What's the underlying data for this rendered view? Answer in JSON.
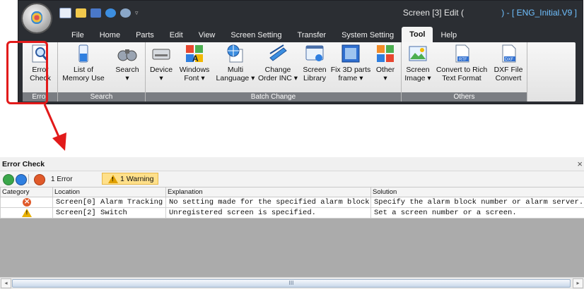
{
  "window": {
    "title_prefix": "Screen [3] Edit (",
    "title_filename": ") - [ ENG_Initial.V9 ]"
  },
  "menu": [
    "File",
    "Home",
    "Parts",
    "Edit",
    "View",
    "Screen Setting",
    "Transfer",
    "System Setting",
    "Tool",
    "Help"
  ],
  "active_menu": "Tool",
  "ribbon": {
    "groups": [
      {
        "label": "Error",
        "buttons": [
          {
            "line1": "Error",
            "line2": "Check",
            "icon": "magnifier-doc-icon"
          }
        ]
      },
      {
        "label": "Search",
        "buttons": [
          {
            "line1": "List of",
            "line2": "Memory Use",
            "icon": "memory-icon"
          },
          {
            "line1": "Search",
            "line2": "▾",
            "icon": "binoculars-icon"
          }
        ]
      },
      {
        "label": "Batch Change",
        "buttons": [
          {
            "line1": "Device",
            "line2": "▾",
            "icon": "device-icon"
          },
          {
            "line1": "Windows",
            "line2": "Font ▾",
            "icon": "windows-font-icon"
          },
          {
            "line1": "Multi",
            "line2": "Language ▾",
            "icon": "globe-doc-icon"
          },
          {
            "line1": "Change",
            "line2": "Order INC ▾",
            "icon": "layers-icon"
          },
          {
            "line1": "Screen",
            "line2": "Library",
            "icon": "screen-library-icon"
          },
          {
            "line1": "Fix 3D parts",
            "line2": "frame ▾",
            "icon": "frame-icon"
          },
          {
            "line1": "Other",
            "line2": "▾",
            "icon": "other-tiles-icon"
          }
        ]
      },
      {
        "label": "Others",
        "buttons": [
          {
            "line1": "Screen",
            "line2": "Image ▾",
            "icon": "image-icon"
          },
          {
            "line1": "Convert to Rich",
            "line2": "Text Format",
            "icon": "rtf-file-icon",
            "badge": "RTF"
          },
          {
            "line1": "DXF File",
            "line2": "Convert",
            "icon": "dxf-file-icon",
            "badge": "DXF"
          }
        ]
      }
    ]
  },
  "error_check": {
    "title": "Error Check",
    "close_glyph": "×",
    "error_count_label": "1 Error",
    "warning_count_label": "1 Warning",
    "columns": [
      "Category",
      "Location",
      "Explanation",
      "Solution"
    ],
    "rows": [
      {
        "category": "error",
        "location": "Screen[0] Alarm Tracking",
        "explanation": "No setting made for the specified alarm block.",
        "solution": "Specify the alarm block number or alarm server."
      },
      {
        "category": "warning",
        "location": "Screen[2] Switch",
        "explanation": "Unregistered screen is specified.",
        "solution": "Set a screen number or a screen."
      }
    ],
    "scroll_left": "◂",
    "scroll_right": "▸",
    "scroll_grip": "III"
  },
  "colors": {
    "highlight": "#e21a1a",
    "ribbon_dark": "#2b2e33",
    "group_label": "#7a7d82",
    "warning_bg": "#ffe08a"
  }
}
